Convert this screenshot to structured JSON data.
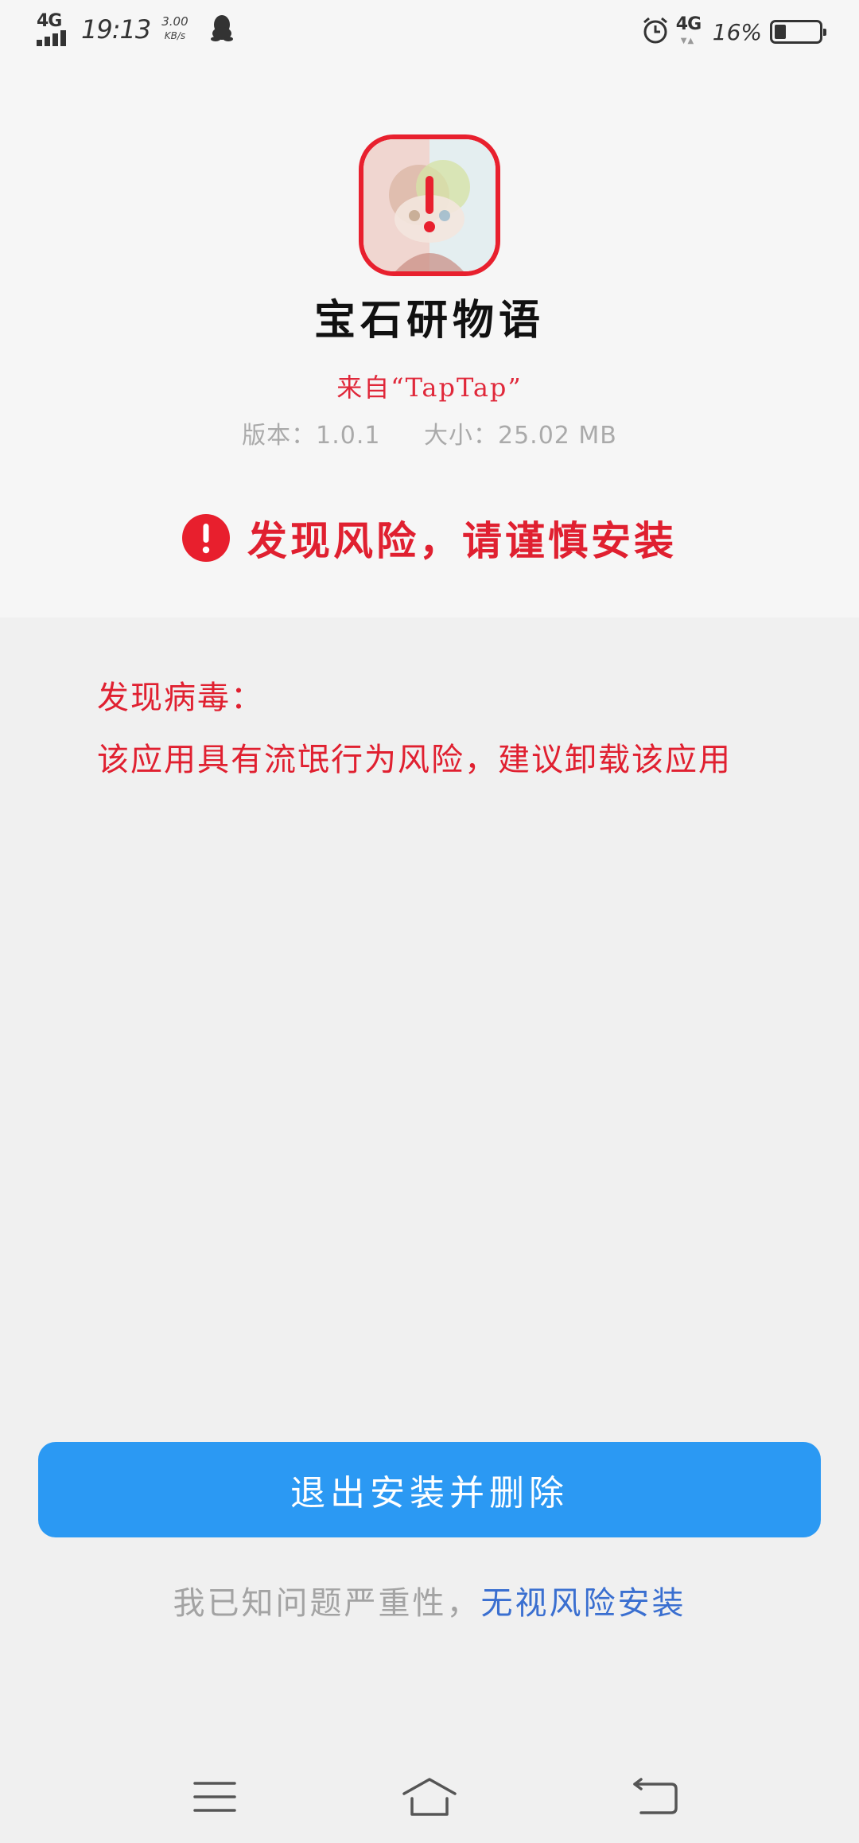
{
  "status_bar": {
    "network_left": "4G",
    "time": "19:13",
    "speed_value": "3.00",
    "speed_unit": "KB/s",
    "qq_icon": "qq-penguin-icon",
    "alarm_icon": "alarm-clock-icon",
    "network_right": "4G",
    "battery_percent": "16%",
    "battery_level": 0.16
  },
  "app": {
    "icon": "app-icon-with-warning",
    "name": "宝石研物语",
    "source": "来自“TapTap”",
    "version": "版本：1.0.1",
    "size": "大小：25.02 MB"
  },
  "risk": {
    "icon": "alert-circle-icon",
    "headline": "发现风险，请谨慎安装"
  },
  "virus": {
    "title": "发现病毒：",
    "description": "该应用具有流氓行为风险，建议卸载该应用"
  },
  "actions": {
    "exit_delete_label": "退出安装并删除",
    "ack_prefix": "我已知问题严重性，",
    "ignore_risk_label": "无视风险安装"
  },
  "nav": {
    "menu_icon": "menu-icon",
    "home_icon": "home-icon",
    "back_icon": "back-icon"
  },
  "colors": {
    "danger": "#e02030",
    "primary": "#2b99f3",
    "link": "#3a6fd0"
  }
}
